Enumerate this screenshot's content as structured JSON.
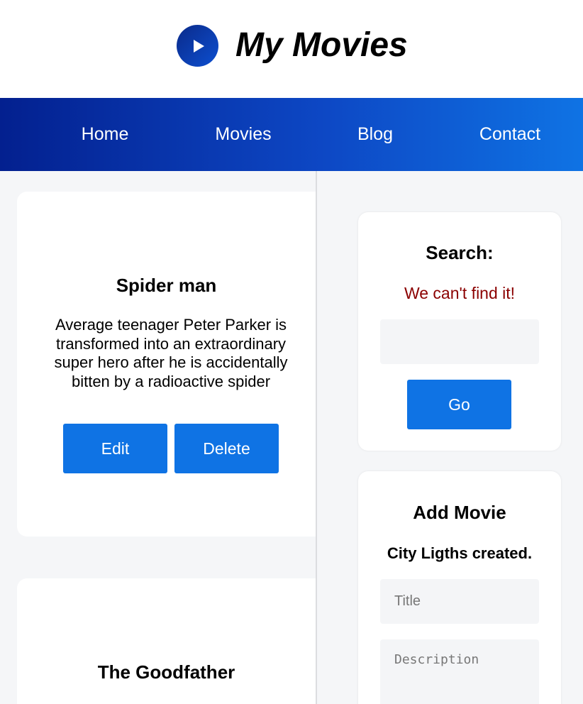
{
  "header": {
    "site_title": "My Movies",
    "logo_icon": "play-icon",
    "accent_color": "#0f73e4"
  },
  "nav": {
    "items": [
      {
        "label": "Home"
      },
      {
        "label": "Movies"
      },
      {
        "label": "Blog"
      },
      {
        "label": "Contact"
      }
    ]
  },
  "movies": [
    {
      "title": "Spider man",
      "description": "Average teenager Peter Parker is transformed into an extraordinary super hero after he is accidentally bitten by a radioactive spider",
      "edit_label": "Edit",
      "delete_label": "Delete"
    },
    {
      "title": "The Goodfather"
    }
  ],
  "search": {
    "heading": "Search:",
    "error_message": "We can't find it!",
    "input_value": "",
    "go_label": "Go"
  },
  "add_movie": {
    "heading": "Add Movie",
    "success_message": "City Ligths created.",
    "title_placeholder": "Title",
    "description_placeholder": "Description"
  }
}
